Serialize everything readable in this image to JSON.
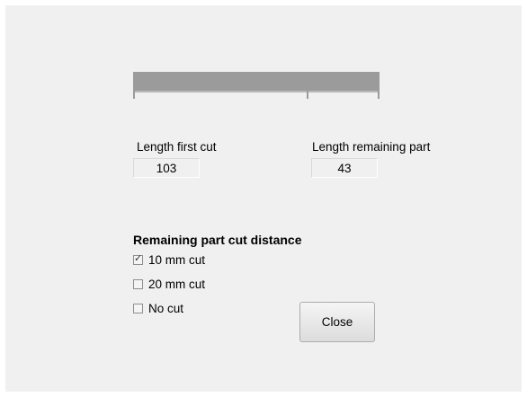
{
  "diagram": {
    "first_cut_fraction": 0.705
  },
  "first_cut": {
    "label": "Length first cut",
    "value": "103"
  },
  "remaining": {
    "label": "Length remaining part",
    "value": "43"
  },
  "cut_distance": {
    "heading": "Remaining part cut distance",
    "options": [
      {
        "label": "10 mm cut",
        "checked": true
      },
      {
        "label": "20 mm cut",
        "checked": false
      },
      {
        "label": "No cut",
        "checked": false
      }
    ]
  },
  "buttons": {
    "close_label": "Close"
  }
}
